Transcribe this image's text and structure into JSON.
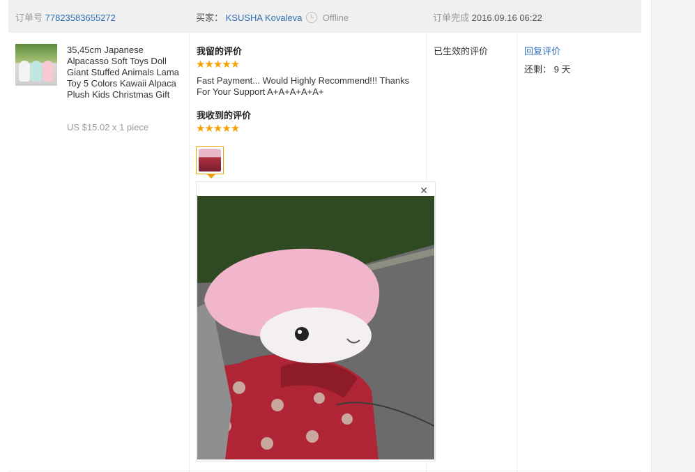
{
  "header": {
    "order_label": "订单号",
    "order_number": "77823583655272",
    "buyer_label": "买家：",
    "buyer_name": "KSUSHA Kovaleva",
    "buyer_status": "Offline",
    "completed_label": "订单完成",
    "completed_time": "2016.09.16 06:22"
  },
  "product": {
    "title": "35,45cm Japanese Alpacasso Soft Toys Doll Giant Stuffed Animals Lama Toy 5 Colors Kawaii Alpaca Plush Kids Christmas Gift",
    "price": "US $15.02 x 1 piece"
  },
  "reviews": {
    "my_review_heading": "我留的评价",
    "my_review_stars": "★★★★★",
    "my_review_text": "Fast Payment... Would Highly Recommend!!! Thanks For Your Support A+A+A+A+A+",
    "received_heading": "我收到的评价",
    "received_stars": "★★★★★",
    "close_glyph": "✕"
  },
  "status": {
    "effective_text": "已生效的评价"
  },
  "actions": {
    "reply_label": "回复评价",
    "remaining": "还剩： 9 天"
  },
  "icons": [
    "clock-icon",
    "close-icon",
    "star-icon"
  ],
  "colors": {
    "link": "#2f6fb3",
    "star": "#f5a000",
    "header_bg": "#f0f0f0"
  }
}
